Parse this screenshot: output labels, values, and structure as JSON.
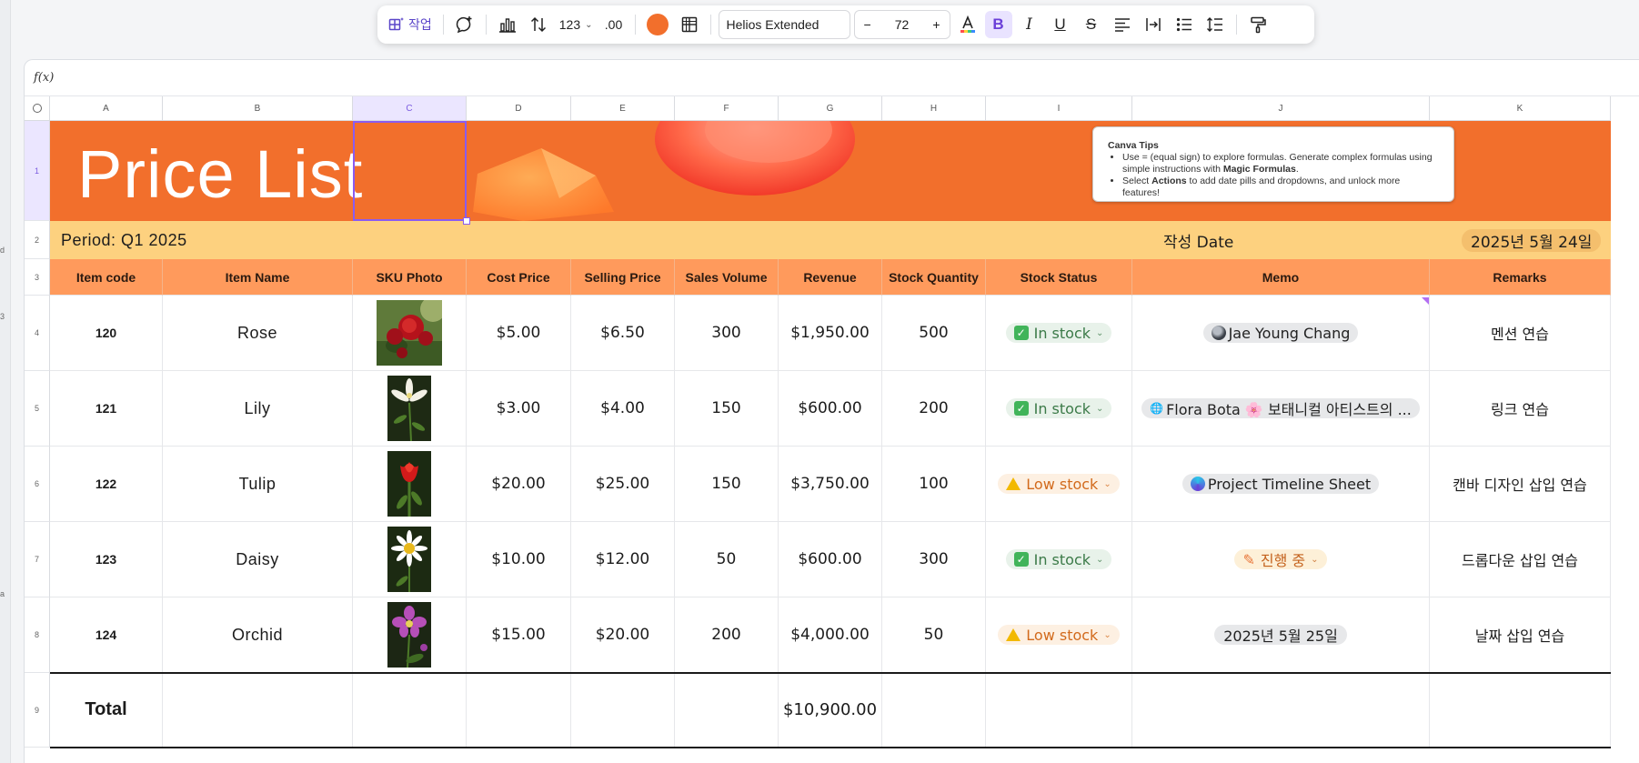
{
  "toolbar": {
    "actions_label": "작업",
    "number_format": "123",
    "decimal_format": ".00",
    "font_name": "Helios Extended",
    "font_size": "72",
    "minus": "−",
    "plus": "+",
    "accent_color": "#f26f2c"
  },
  "formula_bar": {
    "label": "f(x)"
  },
  "columns": [
    "A",
    "B",
    "C",
    "D",
    "E",
    "F",
    "G",
    "H",
    "I",
    "J",
    "K"
  ],
  "rows": [
    "1",
    "2",
    "3",
    "4",
    "5",
    "6",
    "7",
    "8",
    "9"
  ],
  "left_strip_marks": [
    "d",
    "3",
    "a"
  ],
  "banner": {
    "title": "Price List",
    "tips": {
      "title": "Canva Tips",
      "tip1_a": "Use = (equal sign) to explore formulas. Generate complex formulas using simple instructions with ",
      "tip1_b": "Magic Formulas",
      "tip1_c": ".",
      "tip2_a": "Select ",
      "tip2_b": "Actions",
      "tip2_c": " to add date pills and dropdowns, and unlock more features!"
    }
  },
  "period": {
    "label": "Period: Q1 2025",
    "date_label": "작성 Date",
    "date_value": "2025년 5월 24일"
  },
  "headers": [
    "Item code",
    "Item Name",
    "SKU Photo",
    "Cost Price",
    "Selling Price",
    "Sales Volume",
    "Revenue",
    "Stock Quantity",
    "Stock Status",
    "Memo",
    "Remarks"
  ],
  "items": [
    {
      "code": "120",
      "name": "Rose",
      "photo": "rose",
      "cost": "$5.00",
      "sell": "$6.50",
      "volume": "300",
      "revenue": "$1,950.00",
      "qty": "500",
      "status": "In stock",
      "memo": "Jae Young Chang",
      "remarks": "멘션 연습"
    },
    {
      "code": "121",
      "name": "Lily",
      "photo": "lily",
      "cost": "$3.00",
      "sell": "$4.00",
      "volume": "150",
      "revenue": "$600.00",
      "qty": "200",
      "status": "In stock",
      "memo": "Flora Bota 🌸 보태니컬 아티스트의 ...",
      "remarks": "링크 연습"
    },
    {
      "code": "122",
      "name": "Tulip",
      "photo": "tulip",
      "cost": "$20.00",
      "sell": "$25.00",
      "volume": "150",
      "revenue": "$3,750.00",
      "qty": "100",
      "status": "Low stock",
      "memo": "Project Timeline Sheet",
      "remarks": "캔바 디자인 삽입 연습"
    },
    {
      "code": "123",
      "name": "Daisy",
      "photo": "daisy",
      "cost": "$10.00",
      "sell": "$12.00",
      "volume": "50",
      "revenue": "$600.00",
      "qty": "300",
      "status": "In stock",
      "memo": "진행 중",
      "remarks": "드롭다운 삽입 연습"
    },
    {
      "code": "124",
      "name": "Orchid",
      "photo": "orchid",
      "cost": "$15.00",
      "sell": "$20.00",
      "volume": "200",
      "revenue": "$4,000.00",
      "qty": "50",
      "status": "Low stock",
      "memo": "2025년 5월 25일",
      "remarks": "날짜 삽입 연습"
    }
  ],
  "total": {
    "label": "Total",
    "revenue": "$10,900.00"
  },
  "colors": {
    "banner": "#f26f2c",
    "period_row": "#fdd17f",
    "header_row": "#ff9a5c",
    "selection": "#8a5cf0"
  }
}
